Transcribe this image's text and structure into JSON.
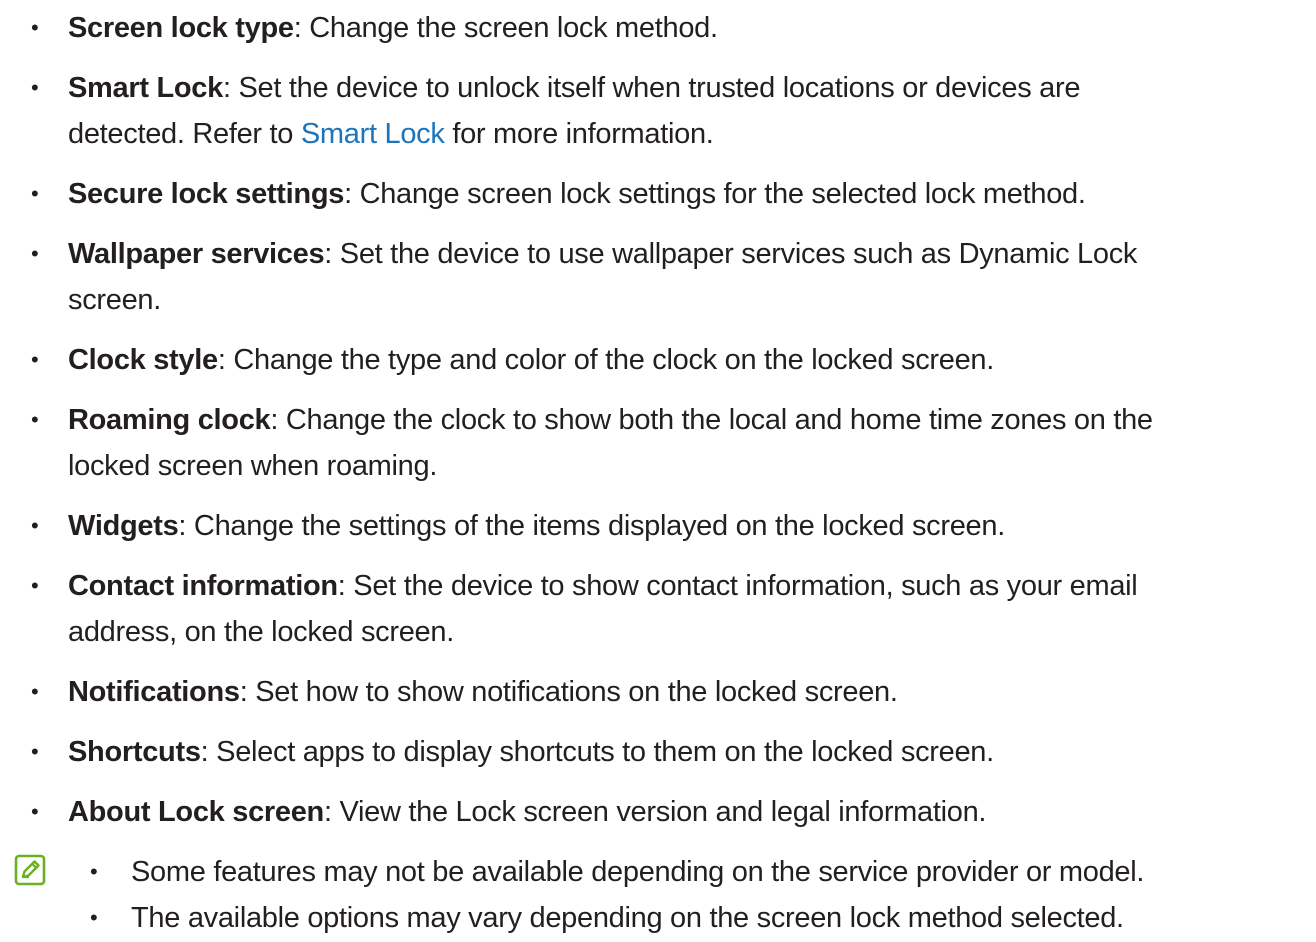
{
  "items": [
    {
      "term": "Screen lock type",
      "desc": ": Change the screen lock method."
    },
    {
      "term": "Smart Lock",
      "desc": ": Set the device to unlock itself when trusted locations or devices are",
      "desc2_pre": "detected. Refer to ",
      "link": "Smart Lock",
      "desc2_post": " for more information."
    },
    {
      "term": "Secure lock settings",
      "desc": ": Change screen lock settings for the selected lock method."
    },
    {
      "term": "Wallpaper services",
      "desc": ": Set the device to use wallpaper services such as Dynamic Lock",
      "desc2": "screen."
    },
    {
      "term": "Clock style",
      "desc": ": Change the type and color of the clock on the locked screen."
    },
    {
      "term": "Roaming clock",
      "desc": ": Change the clock to show both the local and home time zones on the",
      "desc2": "locked screen when roaming."
    },
    {
      "term": "Widgets",
      "desc": ": Change the settings of the items displayed on the locked screen."
    },
    {
      "term": "Contact information",
      "desc": ": Set the device to show contact information, such as your email",
      "desc2": "address, on the locked screen."
    },
    {
      "term": "Notifications",
      "desc": ": Set how to show notifications on the locked screen."
    },
    {
      "term": "Shortcuts",
      "desc": ": Select apps to display shortcuts to them on the locked screen."
    },
    {
      "term": "About Lock screen",
      "desc": ": View the Lock screen version and legal information."
    }
  ],
  "notes": [
    "Some features may not be available depending on the service provider or model.",
    "The available options may vary depending on the screen lock method selected."
  ],
  "bullet_char": "•",
  "colors": {
    "text": "#231f20",
    "link": "#1b75bc",
    "note_icon": "#6ab023"
  },
  "icons": {
    "note": "note-pencil-icon"
  }
}
